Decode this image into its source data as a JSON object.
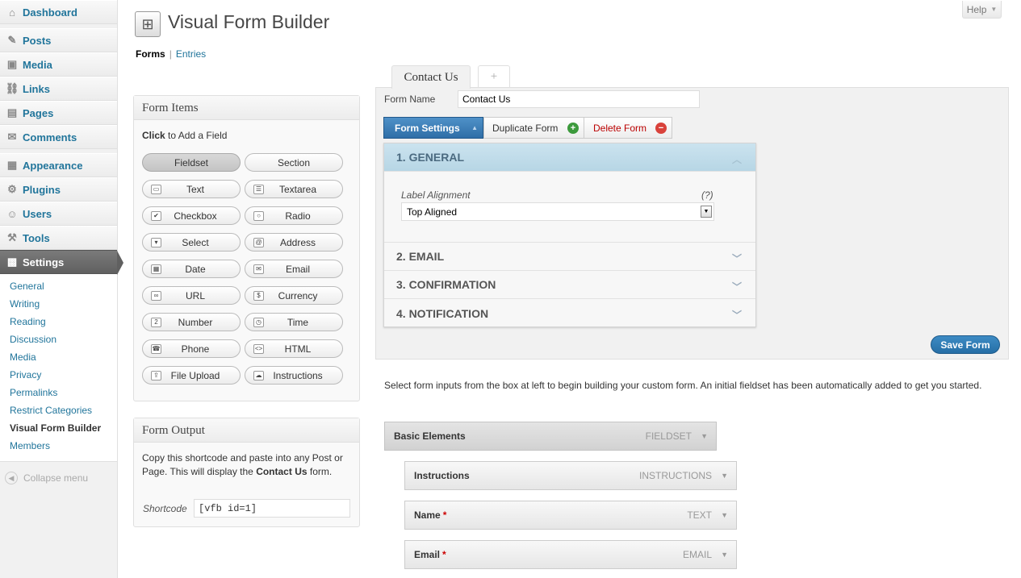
{
  "sidebar": {
    "menu": [
      {
        "label": "Dashboard",
        "icon": "dashboard-icon",
        "glyph": "⌂"
      },
      {
        "label": "Posts",
        "icon": "posts-icon",
        "glyph": "✎"
      },
      {
        "label": "Media",
        "icon": "media-icon",
        "glyph": "▣"
      },
      {
        "label": "Links",
        "icon": "links-icon",
        "glyph": "⛓"
      },
      {
        "label": "Pages",
        "icon": "pages-icon",
        "glyph": "▤"
      },
      {
        "label": "Comments",
        "icon": "comments-icon",
        "glyph": "✉"
      },
      {
        "label": "Appearance",
        "icon": "appearance-icon",
        "glyph": "▦"
      },
      {
        "label": "Plugins",
        "icon": "plugins-icon",
        "glyph": "⚙"
      },
      {
        "label": "Users",
        "icon": "users-icon",
        "glyph": "☺"
      },
      {
        "label": "Tools",
        "icon": "tools-icon",
        "glyph": "⚒"
      },
      {
        "label": "Settings",
        "icon": "settings-icon",
        "glyph": "▩"
      }
    ],
    "submenu": [
      "General",
      "Writing",
      "Reading",
      "Discussion",
      "Media",
      "Privacy",
      "Permalinks",
      "Restrict Categories",
      "Visual Form Builder",
      "Members"
    ],
    "submenu_active": "Visual Form Builder",
    "collapse": "Collapse menu"
  },
  "header": {
    "help": "Help",
    "title": "Visual Form Builder",
    "nav_current": "Forms",
    "nav_link": "Entries"
  },
  "form_items": {
    "title": "Form Items",
    "click": "Click",
    "instr": " to Add a Field",
    "buttons": [
      [
        "Fieldset",
        "Section"
      ],
      [
        "Text",
        "Textarea"
      ],
      [
        "Checkbox",
        "Radio"
      ],
      [
        "Select",
        "Address"
      ],
      [
        "Date",
        "Email"
      ],
      [
        "URL",
        "Currency"
      ],
      [
        "Number",
        "Time"
      ],
      [
        "Phone",
        "HTML"
      ],
      [
        "File Upload",
        "Instructions"
      ]
    ]
  },
  "form_output": {
    "title": "Form Output",
    "text_1": "Copy this shortcode and paste into any Post or Page. This will display the ",
    "form_name": "Contact Us",
    "text_2": " form.",
    "shortcode_label": "Shortcode",
    "shortcode": "[vfb id=1]"
  },
  "tabs": {
    "active": "Contact Us",
    "add": "+"
  },
  "form": {
    "name_label": "Form Name",
    "name_value": "Contact Us",
    "settings_btn": "Form Settings",
    "duplicate_btn": "Duplicate Form",
    "delete_btn": "Delete Form",
    "sections": [
      "1. GENERAL",
      "2. EMAIL",
      "3. CONFIRMATION",
      "4. NOTIFICATION"
    ],
    "label_alignment": "Label Alignment",
    "help": "(?)",
    "alignment_value": "Top Aligned",
    "save": "Save Form"
  },
  "builder": {
    "instructions": "Select form inputs from the box at left to begin building your custom form. An initial fieldset has been automatically added to get you started.",
    "fieldset": {
      "label": "Basic Elements",
      "type": "FIELDSET"
    },
    "fields": [
      {
        "label": "Instructions",
        "type": "INSTRUCTIONS",
        "required": false
      },
      {
        "label": "Name",
        "type": "TEXT",
        "required": true
      },
      {
        "label": "Email",
        "type": "EMAIL",
        "required": true
      }
    ],
    "required_mark": "*"
  },
  "colors": {
    "link": "#21759b",
    "accent": "#2f6ea7",
    "required": "#cc0000"
  }
}
